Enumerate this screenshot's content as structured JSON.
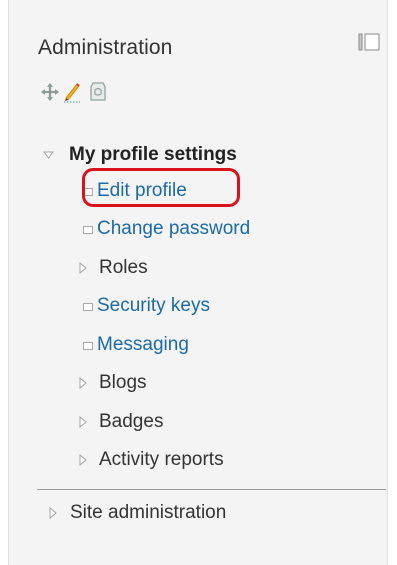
{
  "block": {
    "title": "Administration",
    "dock_icon": "dock-panel-icon",
    "actions": [
      "move-icon",
      "edit-icon",
      "configure-icon"
    ]
  },
  "nav": {
    "section_title": "My profile settings",
    "items": [
      {
        "label": "Edit profile",
        "icon": "leaf-square-icon",
        "highlighted": true
      },
      {
        "label": "Change password",
        "icon": "leaf-square-icon"
      },
      {
        "label": "Roles",
        "icon": "collapsed-triangle-icon"
      },
      {
        "label": "Security keys",
        "icon": "leaf-square-icon"
      },
      {
        "label": "Messaging",
        "icon": "leaf-square-icon"
      },
      {
        "label": "Blogs",
        "icon": "collapsed-triangle-icon"
      },
      {
        "label": "Badges",
        "icon": "collapsed-triangle-icon"
      },
      {
        "label": "Activity reports",
        "icon": "collapsed-triangle-icon"
      }
    ],
    "site_admin_label": "Site administration"
  },
  "colors": {
    "link": "#1b6aa6",
    "text": "#333333",
    "highlight": "#d9121b",
    "panel_bg": "#f4f4f4"
  }
}
